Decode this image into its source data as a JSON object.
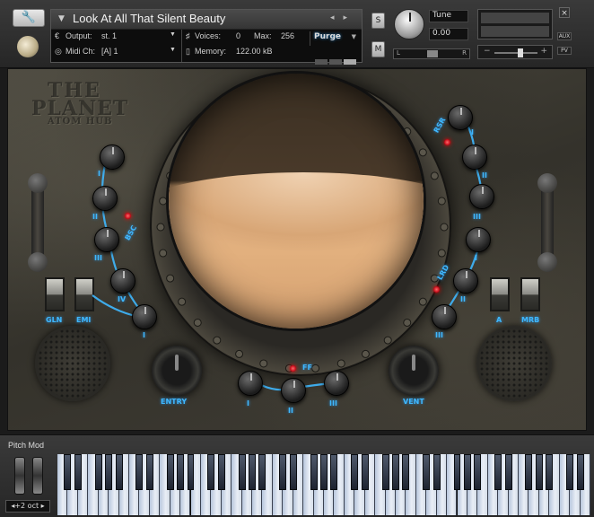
{
  "header": {
    "instrument_name": "Look At All That Silent Beauty",
    "output_label": "Output:",
    "output_value": "st. 1",
    "voices_label": "Voices:",
    "voices_value": "0",
    "max_label": "Max:",
    "max_value": "256",
    "purge_label": "Purge",
    "midi_label": "Midi Ch:",
    "midi_value": "[A]  1",
    "memory_label": "Memory:",
    "memory_value": "122.00 kB",
    "solo_label": "S",
    "mute_label": "M",
    "tune_label": "Tune",
    "tune_value": "0.00",
    "pan_left": "L",
    "pan_right": "R",
    "vol_minus": "−",
    "vol_plus": "+",
    "close_label": "×",
    "aux_label": "AUX",
    "pv_label": "PV"
  },
  "panel": {
    "logo_line1": "THE",
    "logo_line2": "PLANET",
    "logo_line3": "ATOM HUB",
    "left_toggles": [
      "GLN",
      "EMI"
    ],
    "right_toggles": [
      "A",
      "MRB"
    ],
    "left_section_label": "BSC",
    "left_knobs": [
      "I",
      "II",
      "III",
      "IV",
      "I"
    ],
    "right_top_label": "RSR",
    "right_top_knobs": [
      "I",
      "II",
      "III"
    ],
    "right_bottom_label": "LRD",
    "right_bottom_knobs": [
      "I",
      "II",
      "III"
    ],
    "bottom_label": "FF",
    "bottom_knobs": [
      "I",
      "II",
      "III"
    ],
    "entry_label": "ENTRY",
    "vent_label": "VENT"
  },
  "keyboard": {
    "pitch_mod_label": "Pitch Mod",
    "octave_label": "◂+2 oct ▸"
  },
  "colors": {
    "label_blue": "#3fb8ff",
    "led_red": "#ff2020"
  }
}
